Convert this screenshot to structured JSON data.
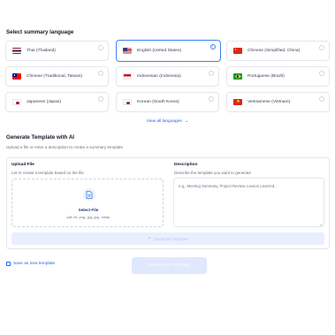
{
  "language_section": {
    "title": "Select summary language",
    "languages": [
      {
        "label": "Thai (Thailand)",
        "flag": "thailand-flag-icon",
        "selected": false
      },
      {
        "label": "English (United States)",
        "flag": "us-flag-icon",
        "selected": true
      },
      {
        "label": "Chinese (Simplified, China)",
        "flag": "china-flag-icon",
        "selected": false
      },
      {
        "label": "Chinese (Traditional, Taiwan)",
        "flag": "taiwan-flag-icon",
        "selected": false
      },
      {
        "label": "Indonesian (Indonesia)",
        "flag": "indonesia-flag-icon",
        "selected": false
      },
      {
        "label": "Portuguese (Brazil)",
        "flag": "brazil-flag-icon",
        "selected": false
      },
      {
        "label": "Japanese (Japan)",
        "flag": "japan-flag-icon",
        "selected": false
      },
      {
        "label": "Korean (South Korea)",
        "flag": "korea-flag-icon",
        "selected": false
      },
      {
        "label": "Vietnamese (Vietnam)",
        "flag": "vietnam-flag-icon",
        "selected": false
      }
    ],
    "view_all": "View all languages"
  },
  "generate_section": {
    "title": "Generate Template with AI",
    "subtitle": "Upload a file or enter a description to create a summary template",
    "upload": {
      "label": "Upload File",
      "hint": "Let AI create a template based on the file",
      "select_label": "Select File",
      "file_types": "pdf, txt, png, .jpg, jpg, .webp"
    },
    "description": {
      "label": "Description",
      "hint": "Describe the template you want to generate",
      "placeholder": "e.g., Meeting Summary, Project Review, Lesson Learned..."
    },
    "generate_button": "Generate Template"
  },
  "footer": {
    "save_link": "Save as new template",
    "summary_button": "Generate AI Summary"
  },
  "colors": {
    "accent": "#3b82f6",
    "link": "#2563eb",
    "disabled_button_bg": "#e8efff"
  }
}
